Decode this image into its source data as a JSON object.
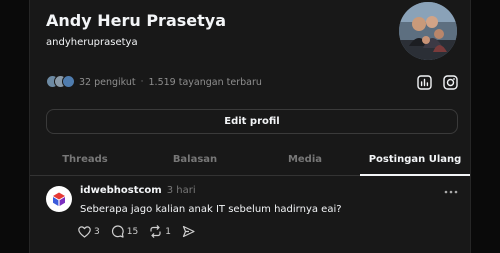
{
  "profile": {
    "name": "Andy Heru Prasetya",
    "handle": "andyheruprasetya",
    "followers": "32 pengikut",
    "separator": "·",
    "views": "1.519 tayangan terbaru"
  },
  "actions": {
    "edit_profile": "Edit profil"
  },
  "tabs": [
    {
      "label": "Threads"
    },
    {
      "label": "Balasan"
    },
    {
      "label": "Media"
    },
    {
      "label": "Postingan Ulang"
    }
  ],
  "active_tab": "Postingan Ulang",
  "post": {
    "username": "idwebhostcom",
    "time": "3 hari",
    "text": "Seberapa jago kalian anak IT sebelum hadirnya eai?",
    "likes": "3",
    "replies": "15",
    "reposts": "1"
  },
  "icons": {
    "insights": "bar-chart-icon",
    "instagram": "instagram-icon",
    "more": "more-dots-icon",
    "like": "heart-icon",
    "reply": "comment-icon",
    "repost": "repost-icon",
    "share": "send-icon"
  },
  "colors": {
    "background": "#0a0a0a",
    "panel": "#181818",
    "text": "#f3f5f7",
    "muted": "#777777"
  }
}
